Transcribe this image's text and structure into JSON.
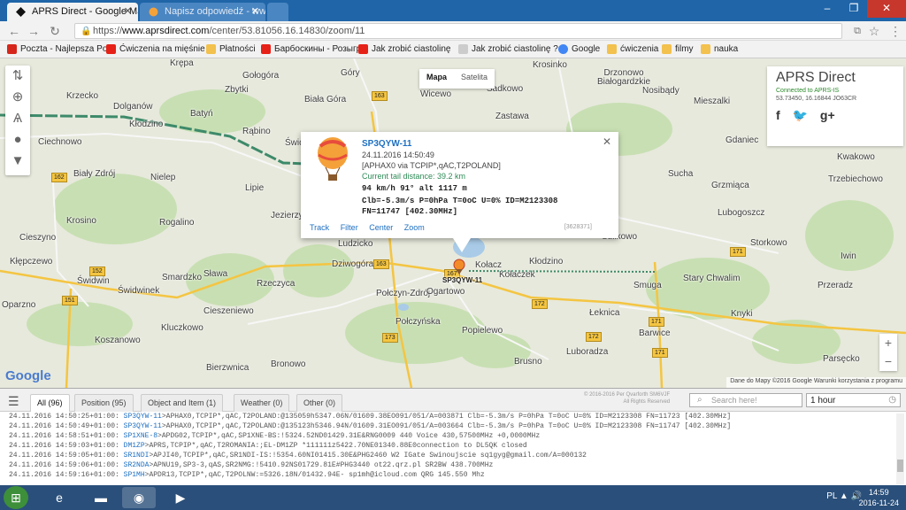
{
  "browser": {
    "tabs": [
      {
        "title": "APRS Direct - Google Ma",
        "favicon": "aprs-diamond-icon"
      },
      {
        "title": "Napisz odpowiedź - www.",
        "favicon": "brainly-icon"
      }
    ],
    "url_scheme": "https://",
    "url_host": "www.aprsdirect.com",
    "url_path": "/center/53.81056.16.14830/zoom/11",
    "bookmarks": [
      {
        "label": "Poczta - Najlepsza Po",
        "icon": "wp-mail-icon",
        "color": "#d6261b"
      },
      {
        "label": "Ćwiczenia na mięśnie",
        "icon": "youtube-icon",
        "color": "#e62117"
      },
      {
        "label": "Płatności",
        "icon": "folder-icon",
        "color": "#f2c14e"
      },
      {
        "label": "Барбоскины - Розыгр",
        "icon": "youtube-icon",
        "color": "#e62117"
      },
      {
        "label": "Jak zrobić ciastolinę",
        "icon": "youtube-icon",
        "color": "#e62117"
      },
      {
        "label": "Jak zrobić ciastolinę ?",
        "icon": "page-icon",
        "color": "#cccccc"
      },
      {
        "label": "Google",
        "icon": "google-icon",
        "color": "#4285f4"
      },
      {
        "label": "ćwiczenia",
        "icon": "folder-icon",
        "color": "#f2c14e"
      },
      {
        "label": "filmy",
        "icon": "folder-icon",
        "color": "#f2c14e"
      },
      {
        "label": "nauka",
        "icon": "folder-icon",
        "color": "#f2c14e"
      }
    ]
  },
  "map": {
    "map_type": [
      "Mapa",
      "Satelita"
    ],
    "selected_type": "Mapa",
    "places": [
      "Krępa",
      "Gołogóra",
      "Krzecko",
      "Dolganów",
      "Batyń",
      "Zbytki",
      "Biała Góra",
      "Góry",
      "Wicewo",
      "Sadkowo",
      "Krosinko",
      "Drzonowo Białogardzkie",
      "Nosibądy",
      "Mieszalki",
      "Kłodzino",
      "Rąbino",
      "Świdwin",
      "Ciechnowo",
      "Biały Zdrój",
      "Nielep",
      "Lipie",
      "Zastawa",
      "Gdaniec",
      "Kwakowo",
      "Sucha",
      "Grzmiąca",
      "Trzebiechowo",
      "Krosino",
      "Rogalino",
      "Jezierzyce",
      "Lubogoszcz",
      "Cieszyno",
      "Kłępczewo",
      "Ludzicko",
      "Kołacz",
      "Kłodzino",
      "Sulikowo",
      "Storkowo",
      "Iwin",
      "Dziwogóra",
      "Kołaczek",
      "Połczyn-Zdrój",
      "Ogartowo",
      "Smuga",
      "Stary Chwalim",
      "Przeradz",
      "Świdwin",
      "Smardzko",
      "Sława",
      "Rzeczyca",
      "Świdwinek",
      "Oparzno",
      "Cieszeniewo",
      "Łeknica",
      "Knyki",
      "Kluczkowo",
      "Połczyńska",
      "Popielewo",
      "Barwice",
      "Koszanowo",
      "Bronowo",
      "Brusno",
      "Luboradza",
      "Bierzwnica",
      "Parsęcko"
    ],
    "roads": [
      "163",
      "162",
      "167",
      "151",
      "152",
      "172",
      "171",
      "173"
    ],
    "brand": {
      "title": "APRS Direct",
      "status": "Connected to APRS-IS",
      "coords": "53.73450, 16.16844 JO63CR"
    },
    "popup": {
      "callsign": "SP3QYW-11",
      "timestamp": "24.11.2016 14:50:49",
      "path": "[APHAX0 via TCPIP*,qAC,T2POLAND]",
      "tail_distance": "Current tail distance: 39.2 km",
      "speed_line": "94 km/h 91° alt 1117 m",
      "telemetry1": "Clb=-5.3m/s P=0hPa T=0oC U=0% ID=M2123308",
      "telemetry2": "FN=11747 [402.30MHz]",
      "links": [
        "Track",
        "Filter",
        "Center",
        "Zoom"
      ],
      "packet_id": "[3628371]"
    },
    "marker_label": "SP3QYW-11",
    "google_logo": "Google",
    "attribution": "Dane do Mapy ©2016 Google   Warunki korzystania z programu"
  },
  "panel": {
    "tabs": [
      "All (96)",
      "Position (95)",
      "Object and Item (1)",
      "Weather (0)",
      "Other (0)"
    ],
    "copyright": "© 2016-2016 Per Qvarforth SM6VJF\nAll Rights Reserved",
    "search_placeholder": "Search here!",
    "period": "1 hour",
    "log": [
      {
        "time": "24.11.2016 14:50:25+01:00:",
        "call": "SP3QYW-11",
        "text": ">APHAX0,TCPIP*,qAC,T2POLAND:@135059h5347.06N/01609.38EO091/051/A=003871 Clb=-5.3m/s P=0hPa T=0oC U=0% ID=M2123308 FN=11723 [402.30MHz]"
      },
      {
        "time": "24.11.2016 14:50:49+01:00:",
        "call": "SP3QYW-11",
        "text": ">APHAX0,TCPIP*,qAC,T2POLAND:@135123h5346.94N/01609.31EO091/051/A=003664 Clb=-5.3m/s P=0hPa T=0oC U=0% ID=M2123308 FN=11747 [402.30MHz]"
      },
      {
        "time": "24.11.2016 14:58:51+01:00:",
        "call": "SP1XNE-8",
        "text": ">APDG02,TCPIP*,qAC,SP1XNE-BS:!5324.52ND01429.31E&RNG0009 440 Voice 430,57500MHz +0,0000MHz"
      },
      {
        "time": "24.11.2016 14:59:03+01:00:",
        "call": "DM1ZP",
        "text": ">APRS,TCPIP*,qAC,T2ROMANIA:;EL-DM1ZP *111111z5422.70NE01340.88E0connection to DL5QK closed"
      },
      {
        "time": "24.11.2016 14:59:05+01:00:",
        "call": "SR1NDI",
        "text": ">APJI40,TCPIP*,qAC,SR1NDI-IS:!5354.60NI01415.30E&PHG2460 W2 IGate Swinoujscie sq1gyg@gmail.com/A=000132"
      },
      {
        "time": "24.11.2016 14:59:06+01:00:",
        "call": "SR2NDA",
        "text": ">APNU19,SP3-3,qAS,SR2NMG:!5410.92NS01729.81E#PHG3440 ot22.qrz.pl SR2BW 438.700MHz"
      },
      {
        "time": "24.11.2016 14:59:16+01:00:",
        "call": "SP1MH",
        "text": ">APDR13,TCPIP*,qAC,T2POLNW:=5326.18N/01432.94E- sp1mh@icloud.com QRG 145.550 Mhz"
      }
    ]
  },
  "taskbar": {
    "time": "14:59",
    "date": "2016-11-24",
    "language": "PL"
  }
}
